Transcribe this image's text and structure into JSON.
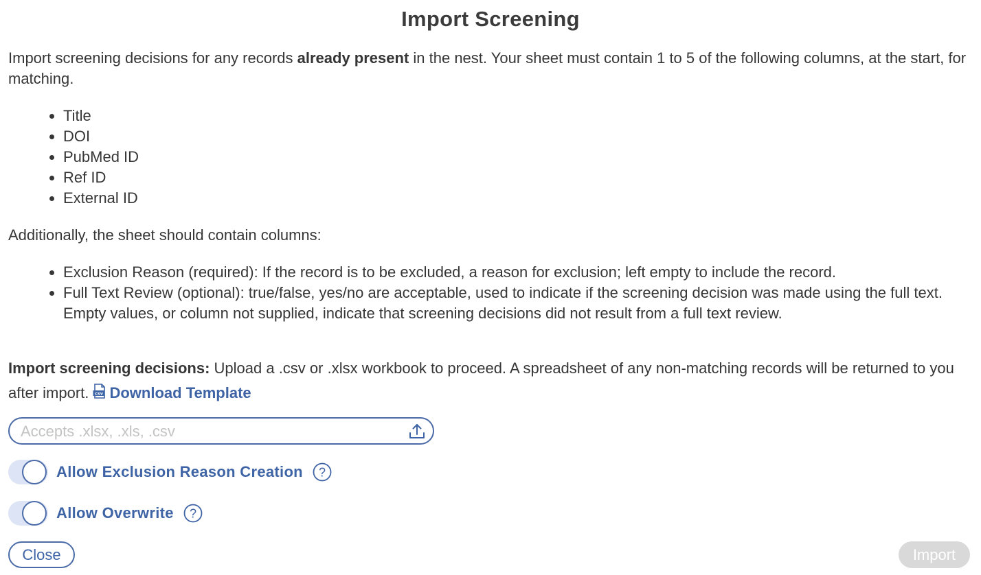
{
  "dialog": {
    "title": "Import Screening"
  },
  "intro": {
    "text_before": "Import screening decisions for any records ",
    "bold": "already present",
    "text_after": " in the nest. Your sheet must contain 1 to 5 of the following columns, at the start, for matching."
  },
  "match_columns": [
    "Title",
    "DOI",
    "PubMed ID",
    "Ref ID",
    "External ID"
  ],
  "additional": {
    "heading": "Additionally, the sheet should contain columns:",
    "items": [
      "Exclusion Reason (required): If the record is to be excluded, a reason for exclusion; left empty to include the record.",
      "Full Text Review (optional): true/false, yes/no are acceptable, used to indicate if the screening decision was made using the full text. Empty values, or column not supplied, indicate that screening decisions did not result from a full text review."
    ]
  },
  "upload": {
    "label_bold": "Import screening decisions:",
    "label_text": " Upload a .csv or .xlsx workbook to proceed. A spreadsheet of any non-matching records will be returned to you after import. ",
    "download_link": "Download Template",
    "download_icon": "csv-file-icon",
    "file_placeholder": "Accepts .xlsx, .xls, .csv",
    "file_value": "",
    "upload_icon": "upload-icon"
  },
  "options": {
    "allow_exclusion_reason_creation": {
      "label": "Allow Exclusion Reason Creation",
      "enabled": true,
      "help_icon": "question-circle-icon"
    },
    "allow_overwrite": {
      "label": "Allow Overwrite",
      "enabled": true,
      "help_icon": "question-circle-icon"
    }
  },
  "footer": {
    "close_label": "Close",
    "import_label": "Import",
    "import_disabled": true
  },
  "colors": {
    "accent": "#3e64a6",
    "toggle_track": "#dde4f6",
    "disabled_button": "#d9d9d9",
    "text": "#363636"
  }
}
